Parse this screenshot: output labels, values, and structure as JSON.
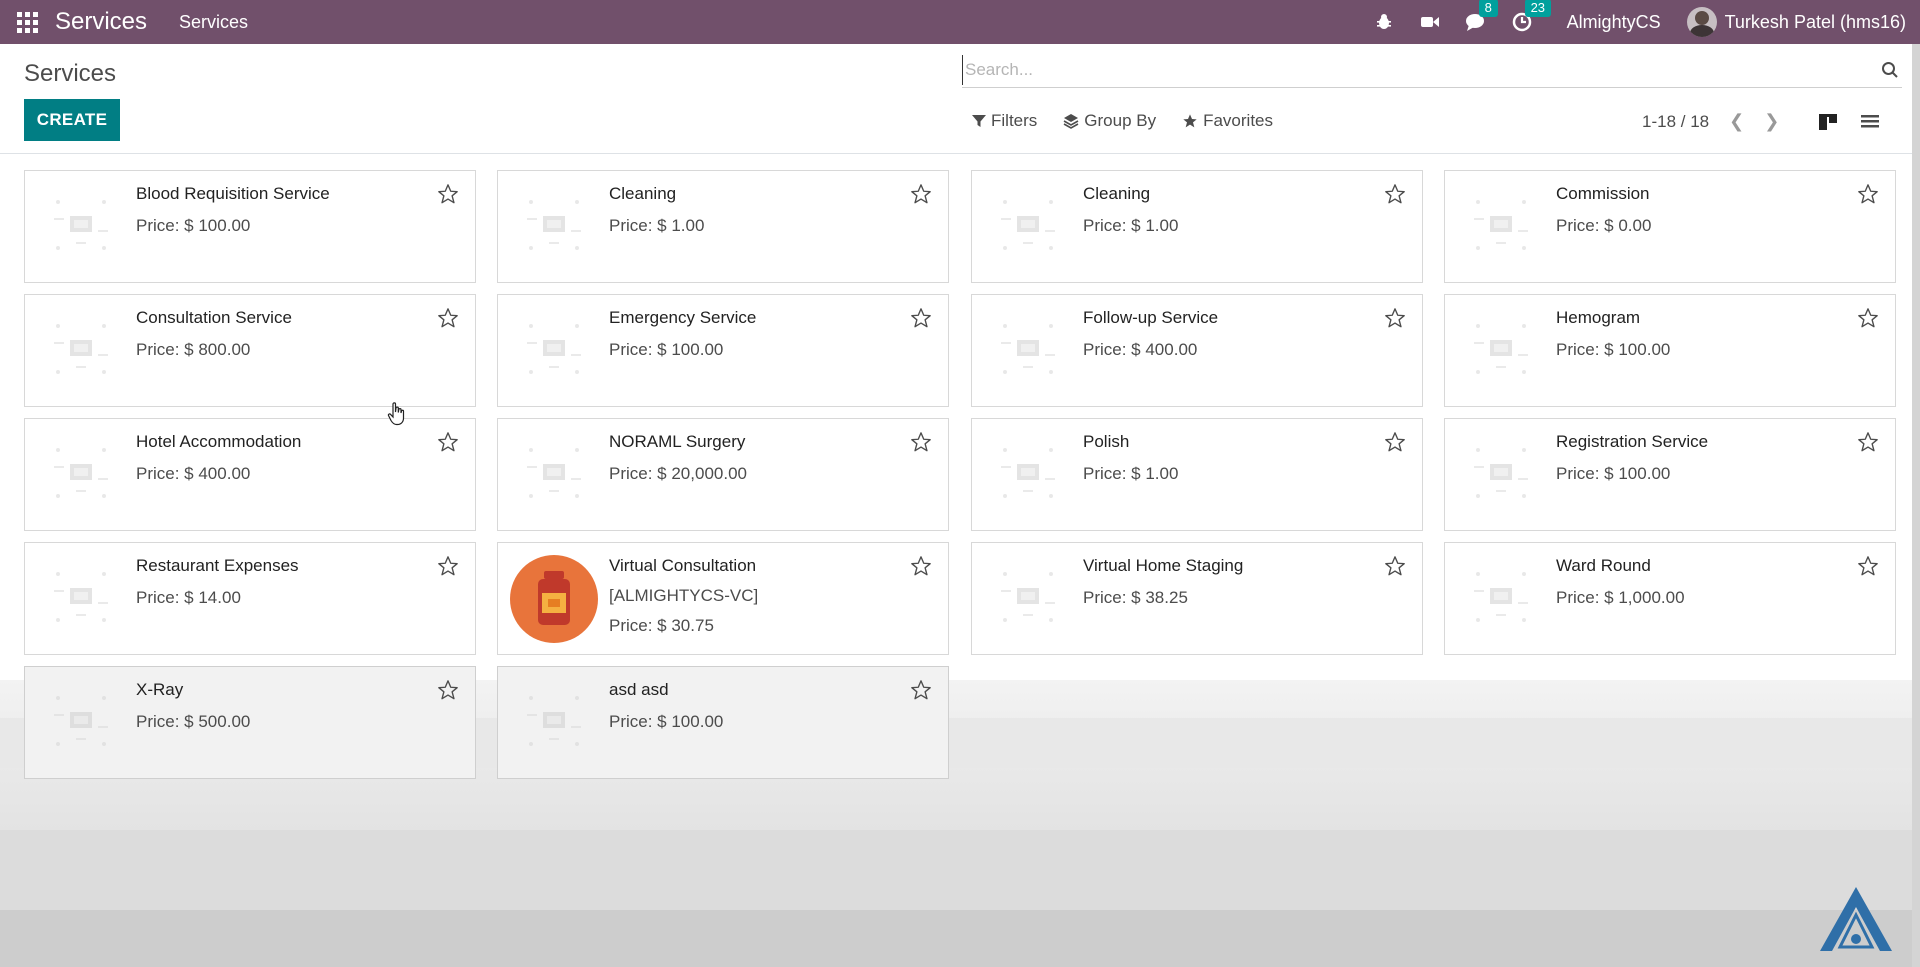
{
  "navbar": {
    "brand": "Services",
    "menu": "Services",
    "messages_count": "8",
    "activities_count": "23",
    "company": "AlmightyCS",
    "user": "Turkesh Patel (hms16)",
    "bg_color": "#71506b"
  },
  "control_panel": {
    "title": "Services",
    "create_label": "CREATE",
    "search_placeholder": "Search...",
    "filters_label": "Filters",
    "group_by_label": "Group By",
    "favorites_label": "Favorites",
    "pager": "1-18 / 18"
  },
  "cards": [
    {
      "name": "Blood Requisition Service",
      "price": "Price: $ 100.00"
    },
    {
      "name": "Cleaning",
      "price": "Price: $ 1.00"
    },
    {
      "name": "Cleaning",
      "price": "Price: $ 1.00"
    },
    {
      "name": "Commission",
      "price": "Price: $ 0.00"
    },
    {
      "name": "Consultation Service",
      "price": "Price: $ 800.00"
    },
    {
      "name": "Emergency Service",
      "price": "Price: $ 100.00"
    },
    {
      "name": "Follow-up Service",
      "price": "Price: $ 400.00"
    },
    {
      "name": "Hemogram",
      "price": "Price: $ 100.00"
    },
    {
      "name": "Hotel Accommodation",
      "price": "Price: $ 400.00"
    },
    {
      "name": "NORAML Surgery",
      "price": "Price: $ 20,000.00"
    },
    {
      "name": "Polish",
      "price": "Price: $ 1.00"
    },
    {
      "name": "Registration Service",
      "price": "Price: $ 100.00"
    },
    {
      "name": "Restaurant Expenses",
      "price": "Price: $ 14.00"
    },
    {
      "name": "Virtual Consultation",
      "code": "[ALMIGHTYCS-VC]",
      "price": "Price: $ 30.75",
      "image": "medicine-bottle-icon"
    },
    {
      "name": "Virtual Home Staging",
      "price": "Price: $ 38.25"
    },
    {
      "name": "Ward Round",
      "price": "Price: $ 1,000.00"
    },
    {
      "name": "X-Ray",
      "price": "Price: $ 500.00"
    },
    {
      "name": "asd asd",
      "price": "Price: $ 100.00"
    }
  ],
  "colors": {
    "accent": "#017e84",
    "badge": "#00a09d",
    "orange": "#e8743b"
  }
}
